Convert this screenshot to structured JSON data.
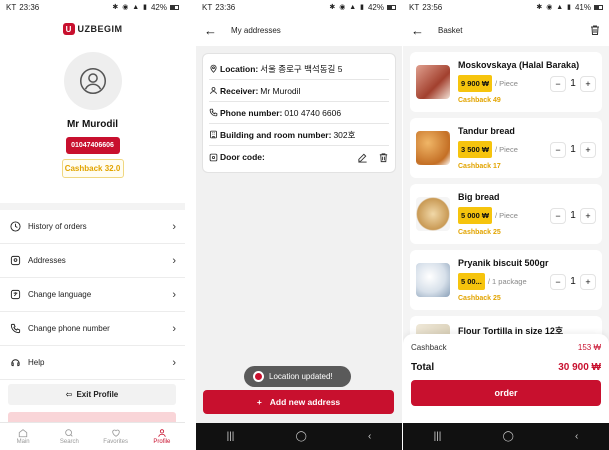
{
  "profile": {
    "status": {
      "time": "23:36",
      "carrier": "KT",
      "battery": "42%"
    },
    "brand": "UZBEGIM",
    "username": "Mr Murodil",
    "phone": "01047406606",
    "cashback": "Cashback 32.0",
    "menu": [
      {
        "label": "History of orders",
        "icon": "clock-icon"
      },
      {
        "label": "Addresses",
        "icon": "location-icon"
      },
      {
        "label": "Change language",
        "icon": "translate-icon"
      },
      {
        "label": "Change phone number",
        "icon": "phone-icon"
      },
      {
        "label": "Help",
        "icon": "help-icon"
      }
    ],
    "exit_label": "Exit Profile",
    "nav": [
      {
        "label": "Main",
        "icon": "home-icon"
      },
      {
        "label": "Search",
        "icon": "search-icon"
      },
      {
        "label": "Favorites",
        "icon": "heart-icon"
      },
      {
        "label": "Profile",
        "icon": "user-icon"
      }
    ]
  },
  "addresses": {
    "status": {
      "time": "23:36",
      "carrier": "KT",
      "battery": "42%"
    },
    "title": "My addresses",
    "fields": [
      {
        "key": "Location:",
        "value": " 서울 종로구 백석동길 5"
      },
      {
        "key": "Receiver:",
        "value": " Mr Murodil"
      },
      {
        "key": "Phone number:",
        "value": " 010 4740 6606"
      },
      {
        "key": "Building and room number:",
        "value": " 302호"
      },
      {
        "key": "Door code:",
        "value": ""
      }
    ],
    "toast": "Location updated!",
    "add_label": "Add new address"
  },
  "basket": {
    "status": {
      "time": "23:56",
      "carrier": "KT",
      "battery": "41%"
    },
    "title": "Basket",
    "products": [
      {
        "name": "Moskovskaya (Halal Baraka)",
        "price": "9 900 ₩",
        "unit": "/ Piece",
        "cashback": "Cashback 49",
        "qty": "1",
        "thumb": "#b5523f"
      },
      {
        "name": "Tandur bread",
        "price": "3 500 ₩",
        "unit": "/ Piece",
        "cashback": "Cashback 17",
        "qty": "1",
        "thumb": "#d4893a"
      },
      {
        "name": "Big bread",
        "price": "5 000 ₩",
        "unit": "/ Piece",
        "cashback": "Cashback 25",
        "qty": "1",
        "thumb": "#d9b37a"
      },
      {
        "name": "Pryanik biscuit 500gr",
        "price": "5 00...",
        "unit": "/ 1 package",
        "cashback": "Cashback 25",
        "qty": "1",
        "thumb": "#cfd8e3"
      },
      {
        "name": "Flour Tortilla in size 12호",
        "price": "",
        "unit": "",
        "cashback": "",
        "qty": "",
        "thumb": "#e8e0cc"
      }
    ],
    "cashback_label": "Cashback",
    "cashback_value": "153 ₩",
    "total_label": "Total",
    "total_value": "30 900 ₩",
    "order_label": "order"
  },
  "colors": {
    "accent": "#c8102e",
    "price_yellow": "#f6c40d",
    "cashback_gold": "#e2a400"
  }
}
